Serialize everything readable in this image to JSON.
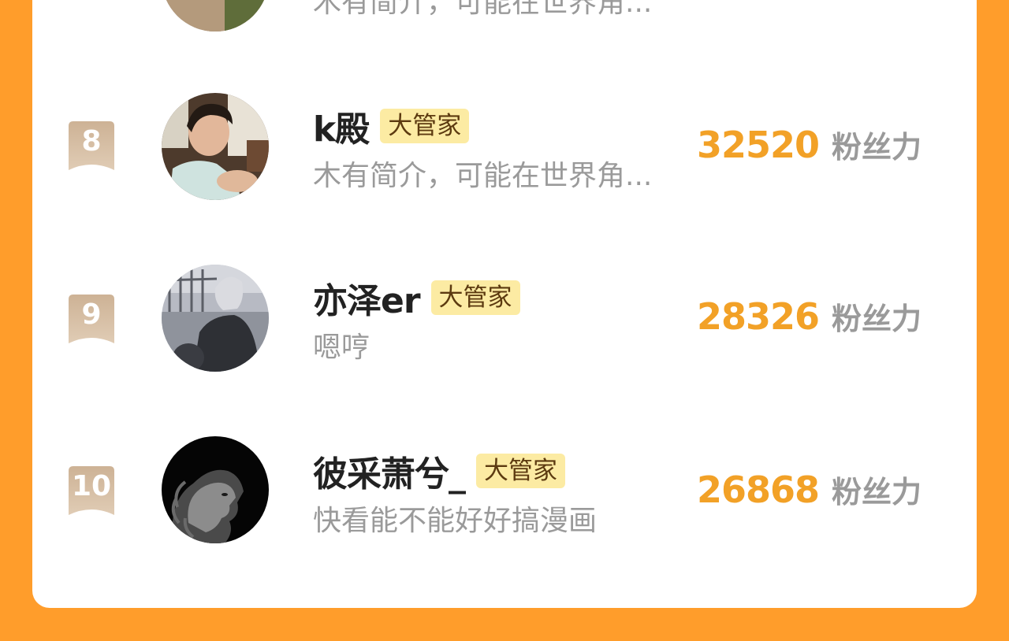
{
  "items": [
    {
      "rank": "",
      "name": "",
      "tag": "",
      "intro": "木有简介，可能在世界角...",
      "fans": "",
      "fans_label": "",
      "avatar": "avatar-photo-partial"
    },
    {
      "rank": "8",
      "name": "k殿",
      "tag": "大管家",
      "intro": "木有简介，可能在世界角...",
      "fans": "32520",
      "fans_label": "粉丝力",
      "avatar": "avatar-photo-boy-in-car"
    },
    {
      "rank": "9",
      "name": "亦泽er",
      "tag": "大管家",
      "intro": "嗯哼",
      "fans": "28326",
      "fans_label": "粉丝力",
      "avatar": "avatar-photo-silver-hair"
    },
    {
      "rank": "10",
      "name": "彼采萧兮_",
      "tag": "大管家",
      "intro": "快看能不能好好搞漫画",
      "fans": "26868",
      "fans_label": "粉丝力",
      "avatar": "avatar-photo-lion"
    }
  ],
  "colors": {
    "background": "#FF9D2B",
    "card": "#FFFFFF",
    "fans_number": "#F2A127",
    "badge": "#D2B89D",
    "tag_bg": "#FCEBA3"
  }
}
